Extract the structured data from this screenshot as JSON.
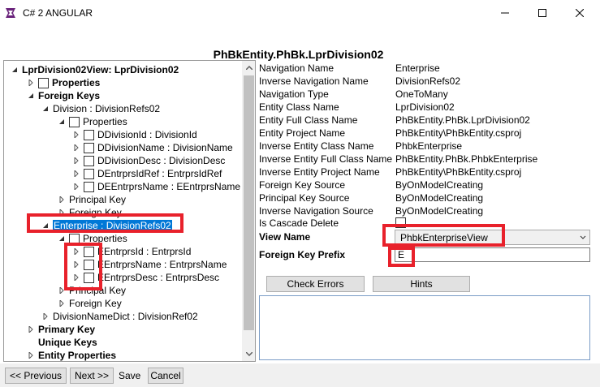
{
  "window": {
    "title": "C# 2 ANGULAR"
  },
  "header": {
    "title": "PhBkEntity.PhBk.LprDivision02"
  },
  "tree": {
    "items": [
      {
        "label": "LprDivision02View: LprDivision02"
      },
      {
        "label": "Properties"
      },
      {
        "label": "Foreign Keys"
      },
      {
        "label": "Division : DivisionRefs02"
      },
      {
        "label": "Properties"
      },
      {
        "label": "DDivisionId : DivisionId"
      },
      {
        "label": "DDivisionName : DivisionName"
      },
      {
        "label": "DDivisionDesc : DivisionDesc"
      },
      {
        "label": "DEntrprsIdRef : EntrprsIdRef"
      },
      {
        "label": "DEEntrprsName : EEntrprsName"
      },
      {
        "label": "Principal Key"
      },
      {
        "label": "Foreign Key"
      },
      {
        "label": "Enterprise : DivisionRefs02"
      },
      {
        "label": "Properties"
      },
      {
        "label": "EEntrprsId : EntrprsId"
      },
      {
        "label": "EEntrprsName : EntrprsName"
      },
      {
        "label": "EEntrprsDesc : EntrprsDesc"
      },
      {
        "label": "Principal Key"
      },
      {
        "label": "Foreign Key"
      },
      {
        "label": "DivisionNameDict : DivisionRef02"
      },
      {
        "label": "Primary Key"
      },
      {
        "label": "Unique Keys"
      },
      {
        "label": "Entity Properties"
      }
    ]
  },
  "properties": {
    "rows": [
      {
        "label": "Navigation Name",
        "value": "Enterprise"
      },
      {
        "label": "Inverse Navigation Name",
        "value": "DivisionRefs02"
      },
      {
        "label": "Navigation Type",
        "value": "OneToMany"
      },
      {
        "label": "Entity Class Name",
        "value": "LprDivision02"
      },
      {
        "label": "Entity Full Class Name",
        "value": "PhBkEntity.PhBk.LprDivision02"
      },
      {
        "label": "Entity Project Name",
        "value": "PhBkEntity\\PhBkEntity.csproj"
      },
      {
        "label": "Inverse Entity Class Name",
        "value": "PhbkEnterprise"
      },
      {
        "label": "Inverse Entity Full Class Name",
        "value": "PhBkEntity.PhBk.PhbkEnterprise"
      },
      {
        "label": "Inverse Entity Project Name",
        "value": "PhBkEntity\\PhBkEntity.csproj"
      },
      {
        "label": "Foreign Key Source",
        "value": "ByOnModelCreating"
      },
      {
        "label": "Principal Key Source",
        "value": "ByOnModelCreating"
      },
      {
        "label": "Inverse Navigation Source",
        "value": "ByOnModelCreating"
      }
    ],
    "cascade_label": "Is Cascade Delete",
    "view_name_label": "View Name",
    "view_name_value": "PhbkEnterpriseView",
    "fk_prefix_label": "Foreign Key Prefix",
    "fk_prefix_value": "E"
  },
  "buttons": {
    "check_errors": "Check Errors",
    "hints": "Hints"
  },
  "footer": {
    "previous": "<< Previous",
    "next": "Next >>",
    "save": "Save",
    "cancel": "Cancel"
  },
  "colors": {
    "selection": "#0078d7",
    "annotation_red": "#e8212b"
  }
}
